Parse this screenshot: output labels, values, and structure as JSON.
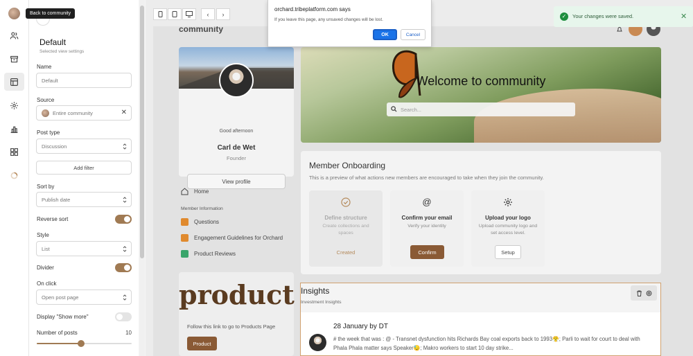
{
  "tooltip": "Back to community",
  "rail": {
    "items": [
      "people-icon",
      "archive-icon",
      "layout-icon",
      "gear-icon",
      "chart-icon",
      "apps-icon",
      "spinner-icon"
    ]
  },
  "panel": {
    "title": "Default",
    "subtitle": "Selected view settings",
    "name_label": "Name",
    "name_value": "Default",
    "source_label": "Source",
    "source_value": "Entire community",
    "post_type_label": "Post type",
    "post_type_value": "Discussion",
    "add_filter": "Add filter",
    "sort_by_label": "Sort by",
    "sort_by_value": "Publish date",
    "reverse_sort_label": "Reverse sort",
    "reverse_sort_on": true,
    "style_label": "Style",
    "style_value": "List",
    "divider_label": "Divider",
    "divider_on": true,
    "on_click_label": "On click",
    "on_click_value": "Open post page",
    "show_more_label": "Display \"Show more\"",
    "show_more_on": false,
    "num_posts_label": "Number of posts",
    "num_posts_value": "10",
    "num_posts_fraction": 0.47
  },
  "site": {
    "brand": "community",
    "greeting": "Good afternoon",
    "user_name": "Carl de Wet",
    "user_role": "Founder",
    "view_profile": "View profile",
    "nav_home": "Home",
    "nav_section": "Member Information",
    "nav_items": [
      {
        "label": "Questions",
        "color": "#e08a2e"
      },
      {
        "label": "Engagement Guidelines for Orchard",
        "color": "#e08a2e"
      },
      {
        "label": "Product Reviews",
        "color": "#3aa56b"
      }
    ],
    "hero_title": "Welcome to community",
    "search_placeholder": "Search...",
    "onboarding_title": "Member Onboarding",
    "onboarding_sub": "This is a preview of what actions new members are encouraged to take when they join the community.",
    "onboarding_cards": [
      {
        "icon": "check-circle-icon",
        "title": "Define structure",
        "desc": "Create collections and spaces",
        "button": "Created"
      },
      {
        "icon": "at-icon",
        "title": "Confirm your email",
        "desc": "Verify your identity",
        "button": "Confirm"
      },
      {
        "icon": "gear-icon",
        "title": "Upload your logo",
        "desc": "Upload community logo and set access level.",
        "button": "Setup"
      }
    ],
    "product_big": "product",
    "product_text": "Follow this link to go to Products Page",
    "product_button": "Product",
    "insights_title": "Insights",
    "insights_sub": "Investment Insights",
    "post_date": "28 January by DT",
    "post_text": "# the week that was : @ - Transnet dysfunction hits Richards Bay coal exports back to 1993😤; Parli to wait for court to deal with Phala Phala matter says Speaker😓; Makro workers to start 10 day strike..."
  },
  "dialog": {
    "host": "orchard.tribeplatform.com says",
    "message": "If you leave this page, any unsaved changes will be lost.",
    "ok": "OK",
    "cancel": "Cancel"
  },
  "toast": {
    "message": "Your changes were saved.",
    "close": "✕"
  },
  "colors": {
    "accent": "#a07a53",
    "success": "#1e8e3e",
    "dialog_ok": "#1a73e8"
  }
}
